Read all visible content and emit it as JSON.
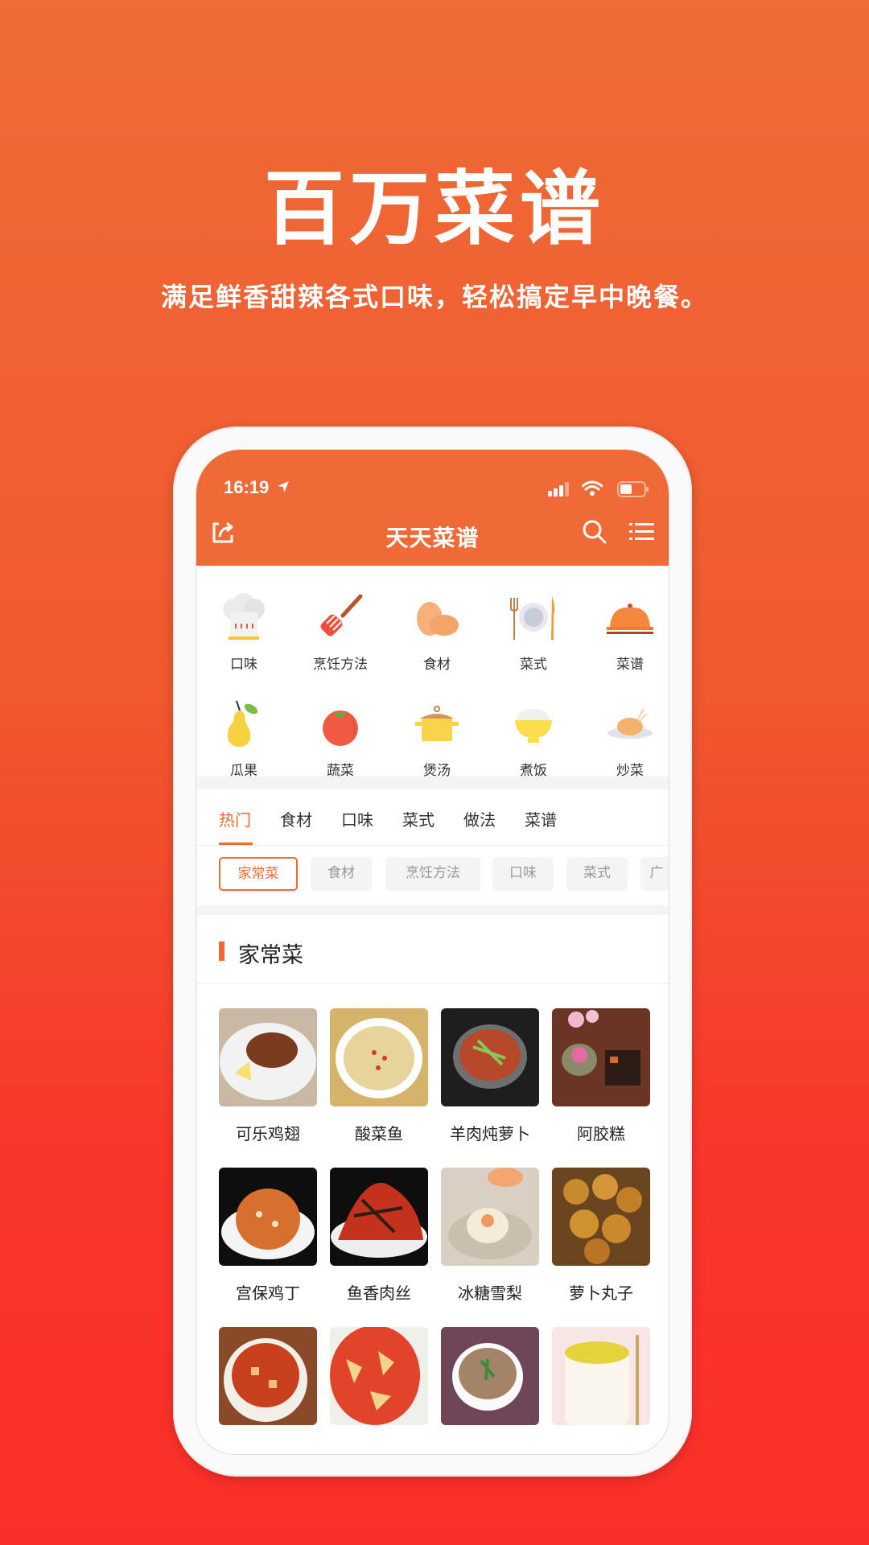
{
  "promo": {
    "title": "百万菜谱",
    "subtitle": "满足鲜香甜辣各式口味，轻松搞定早中晚餐。"
  },
  "status_bar": {
    "time": "16:19",
    "icons": [
      "location-arrow-icon",
      "signal-icon",
      "wifi-icon",
      "battery-icon"
    ]
  },
  "app_bar": {
    "title": "天天菜谱",
    "left_icon": "share-icon",
    "right_icons": [
      "search-icon",
      "menu-list-icon"
    ]
  },
  "categories": [
    {
      "label": "口味",
      "icon": "chef-hat-icon"
    },
    {
      "label": "烹饪方法",
      "icon": "spatula-icon"
    },
    {
      "label": "食材",
      "icon": "eggs-icon"
    },
    {
      "label": "菜式",
      "icon": "plate-cutlery-icon"
    },
    {
      "label": "菜谱",
      "icon": "cloche-icon"
    },
    {
      "label": "瓜果",
      "icon": "pear-icon"
    },
    {
      "label": "蔬菜",
      "icon": "tomato-icon"
    },
    {
      "label": "煲汤",
      "icon": "pot-icon"
    },
    {
      "label": "煮饭",
      "icon": "rice-bowl-icon"
    },
    {
      "label": "炒菜",
      "icon": "roast-chicken-icon"
    }
  ],
  "tabs": [
    {
      "label": "热门",
      "active": true
    },
    {
      "label": "食材",
      "active": false
    },
    {
      "label": "口味",
      "active": false
    },
    {
      "label": "菜式",
      "active": false
    },
    {
      "label": "做法",
      "active": false
    },
    {
      "label": "菜谱",
      "active": false
    }
  ],
  "chips": [
    {
      "label": "家常菜",
      "active": true
    },
    {
      "label": "食材",
      "active": false
    },
    {
      "label": "烹饪方法",
      "active": false
    },
    {
      "label": "口味",
      "active": false
    },
    {
      "label": "菜式",
      "active": false
    },
    {
      "label": "广",
      "active": false
    }
  ],
  "section": {
    "title": "家常菜"
  },
  "recipes": [
    {
      "name": "可乐鸡翅"
    },
    {
      "name": "酸菜鱼"
    },
    {
      "name": "羊肉炖萝卜"
    },
    {
      "name": "阿胶糕"
    },
    {
      "name": "宫保鸡丁"
    },
    {
      "name": "鱼香肉丝"
    },
    {
      "name": "冰糖雪梨"
    },
    {
      "name": "萝卜丸子"
    },
    {
      "name": ""
    },
    {
      "name": ""
    },
    {
      "name": ""
    },
    {
      "name": ""
    }
  ],
  "colors": {
    "accent": "#ef6a36",
    "background_top": "#ef6b37",
    "background_bottom": "#fb2f29"
  }
}
